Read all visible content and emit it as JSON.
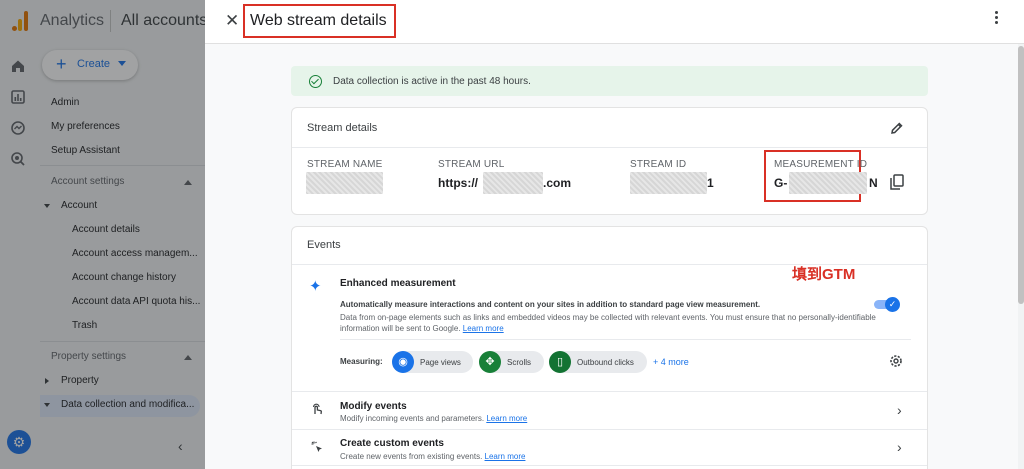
{
  "app": {
    "name": "Analytics",
    "account_selector": "All accounts",
    "create_label": "Create"
  },
  "nav": {
    "admin": "Admin",
    "my_preferences": "My preferences",
    "setup_assistant": "Setup Assistant",
    "account_settings": "Account settings",
    "account": "Account",
    "account_items": [
      "Account details",
      "Account access managem...",
      "Account change history",
      "Account data API quota his...",
      "Trash"
    ],
    "property_settings": "Property settings",
    "property": "Property",
    "data_collection": "Data collection and modifica..."
  },
  "drawer": {
    "title": "Web stream details",
    "banner": "Data collection is active in the past 48 hours."
  },
  "stream_details": {
    "title": "Stream details",
    "stream_name_label": "STREAM NAME",
    "stream_url_label": "STREAM URL",
    "stream_url_prefix": "https://",
    "stream_url_suffix": ".com",
    "stream_id_label": "STREAM ID",
    "stream_id_suffix": "1",
    "measurement_id_label": "MEASUREMENT ID",
    "measurement_id_prefix": "G-",
    "measurement_id_suffix": "N"
  },
  "annotation": "填到GTM",
  "events": {
    "title": "Events",
    "enhanced": {
      "title": "Enhanced measurement",
      "desc": "Automatically measure interactions and content on your sites in addition to standard page view measurement.",
      "text": "Data from on-page elements such as links and embedded videos may be collected with relevant events. You must ensure that no personally-identifiable information will be sent to Google.",
      "learn_more": "Learn more",
      "enabled": true
    },
    "measuring_label": "Measuring:",
    "chips": [
      {
        "label": "Page views",
        "color": "#1a73e8",
        "icon": "eye-icon"
      },
      {
        "label": "Scrolls",
        "color": "#188038",
        "icon": "scroll-target-icon"
      },
      {
        "label": "Outbound clicks",
        "color": "#137333",
        "icon": "mouse-icon"
      }
    ],
    "more": "+ 4 more",
    "modify": {
      "title": "Modify events",
      "desc": "Modify incoming events and parameters.",
      "learn_more": "Learn more"
    },
    "custom": {
      "title": "Create custom events",
      "desc": "Create new events from existing events.",
      "learn_more": "Learn more"
    }
  },
  "colors": {
    "accent": "#1a73e8",
    "annotation_red": "#d93025",
    "success_bg": "#e6f4ea"
  }
}
